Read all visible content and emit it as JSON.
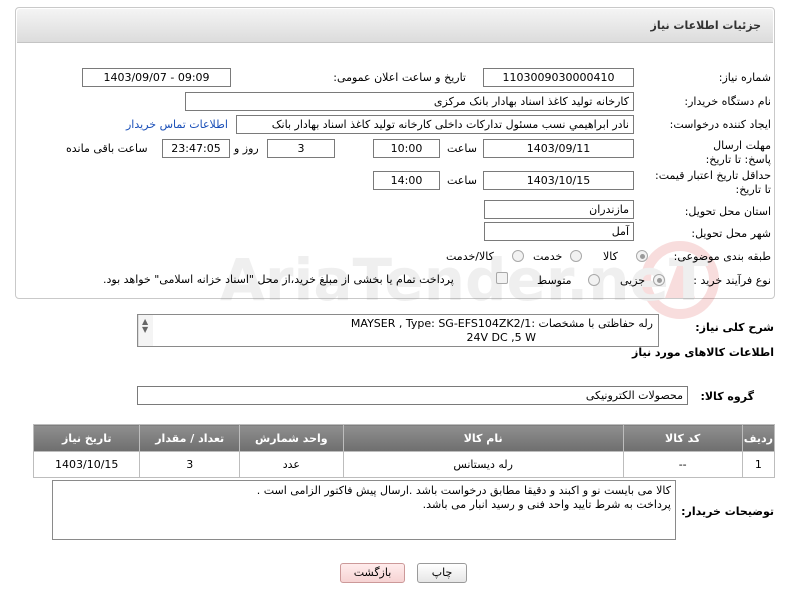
{
  "header": {
    "title": "جزئیات اطلاعات نیاز"
  },
  "fields": {
    "need_number_label": "شماره نیاز:",
    "need_number": "1103009030000410",
    "announce_label": "تاریخ و ساعت اعلان عمومی:",
    "announce_value": "1403/09/07 - 09:09",
    "buyer_org_label": "نام دستگاه خریدار:",
    "buyer_org": "کارخانه تولید کاغذ اسناد بهادار بانک مرکزی",
    "requester_label": "ایجاد کننده درخواست:",
    "requester": "نادر ابراهیمي نسب مسئول تداركات داخلی کارخانه تولید کاغذ اسناد بهادار بانک",
    "contact_link": "اطلاعات تماس خریدار",
    "reply_deadline_label": "مهلت ارسال پاسخ: تا تاریخ:",
    "reply_date": "1403/09/11",
    "time_label": "ساعت",
    "reply_time": "10:00",
    "day_and_label": "روز و",
    "days": "3",
    "remaining_time": "23:47:05",
    "remaining_label": "ساعت باقی مانده",
    "price_validity_label": "حداقل تاریخ اعتبار قیمت: تا تاریخ:",
    "price_date": "1403/10/15",
    "price_time": "14:00",
    "province_label": "استان محل تحویل:",
    "province": "مازندران",
    "city_label": "شهر محل تحویل:",
    "city": "آمل",
    "category_label": "طبقه بندی موضوعی:",
    "category_options": [
      "کالا",
      "خدمت",
      "کالا/خدمت"
    ],
    "purchase_type_label": "نوع فرآیند خرید :",
    "purchase_options": [
      "جزیی",
      "متوسط"
    ],
    "purchase_note": "پرداخت تمام یا بخشی از مبلغ خرید،از محل \"اسناد خزانه اسلامی\" خواهد بود."
  },
  "summary": {
    "label": "شرح کلی نیاز:",
    "line1": "رله حفاظتی با مشخصات :MAYSER , Type: SG-EFS104ZK2/1",
    "line2": "24V DC ,5 W"
  },
  "goods": {
    "section_title": "اطلاعات کالاهای مورد نیاز",
    "group_label": "گروه کالا:",
    "group_value": "محصولات الکترونیکی",
    "columns": [
      "ردیف",
      "کد کالا",
      "نام کالا",
      "واحد شمارش",
      "تعداد / مقدار",
      "تاریخ نیاز"
    ],
    "rows": [
      [
        "1",
        "--",
        "رله دیستانس",
        "عدد",
        "3",
        "1403/10/15"
      ]
    ]
  },
  "notes": {
    "label": "توضیحات خریدار:",
    "line1": "کالا می بایست نو و اکبند و دقیقا مطابق درخواست باشد .ارسال پیش فاکتور الزامی است .",
    "line2": "پرداخت به شرط تایید واحد فنی و رسید انبار می باشد."
  },
  "buttons": {
    "print": "چاپ",
    "back": "بازگشت"
  },
  "watermark": "ParsNamadData AriaTender.neT"
}
